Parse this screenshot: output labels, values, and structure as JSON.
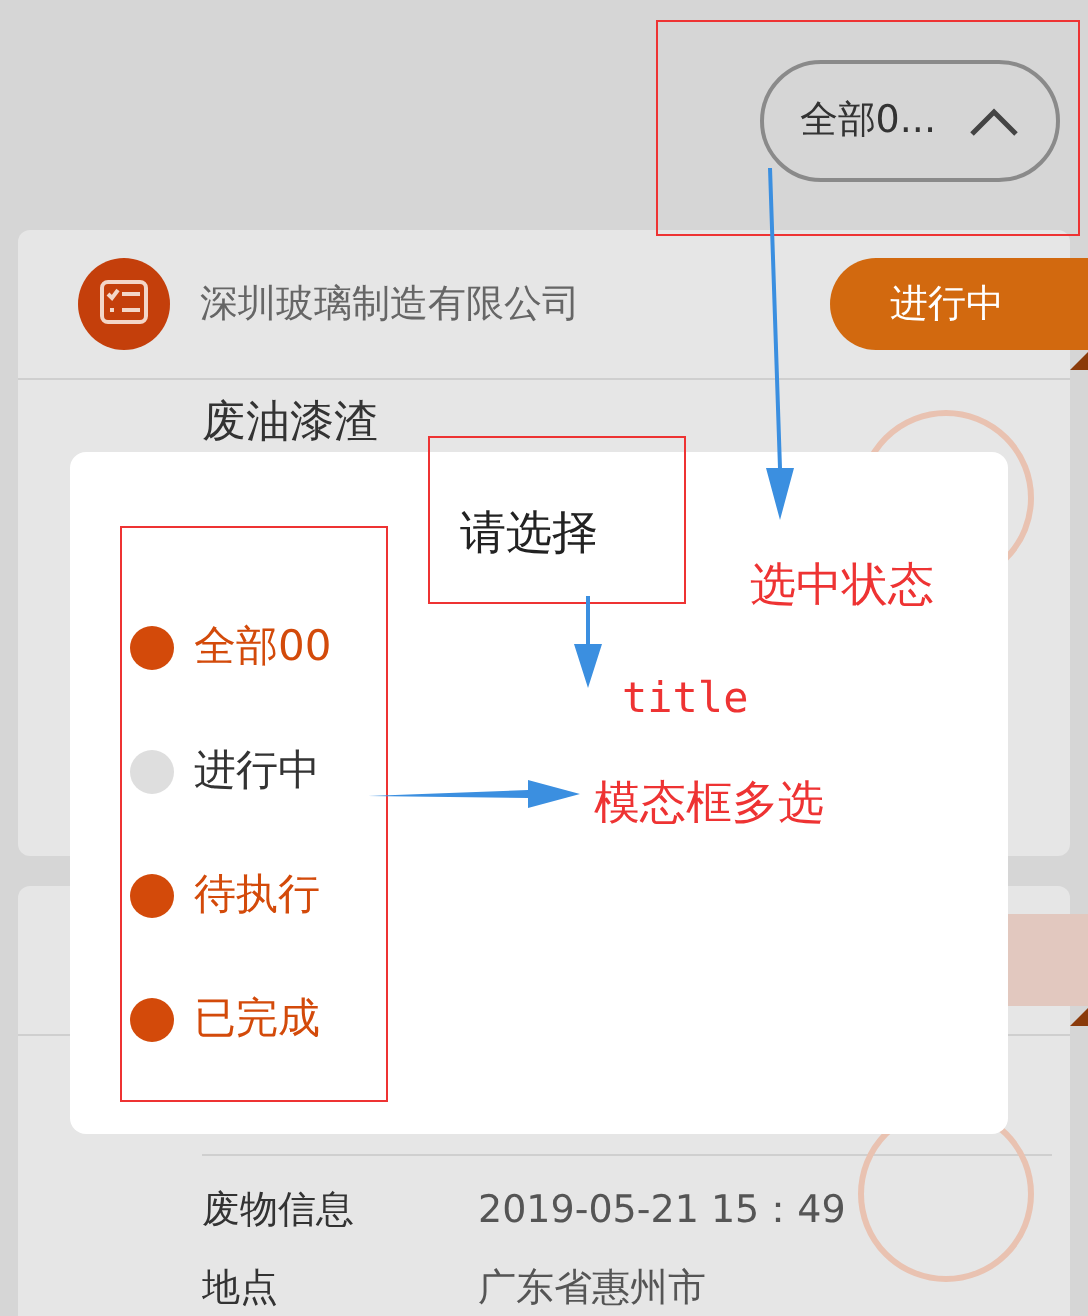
{
  "filter": {
    "label": "全部0...",
    "expanded": true
  },
  "cards": [
    {
      "company": "深圳玻璃制造有限公司",
      "status": "进行中",
      "color": "#d2690f",
      "waste": "废油漆渣"
    },
    {
      "color": "#e2c8bf",
      "fields": [
        {
          "label": "废物信息",
          "value": "2019-05-21 15：49"
        },
        {
          "label": "地点",
          "value": "广东省惠州市"
        }
      ]
    }
  ],
  "modal": {
    "title": "请选择",
    "options": [
      {
        "label": "全部00",
        "selected": true
      },
      {
        "label": "进行中",
        "selected": false
      },
      {
        "label": "待执行",
        "selected": true
      },
      {
        "label": "已完成",
        "selected": true
      }
    ]
  },
  "annotations": [
    {
      "text": "选中状态"
    },
    {
      "text": "title"
    },
    {
      "text": "模态框多选"
    }
  ]
}
